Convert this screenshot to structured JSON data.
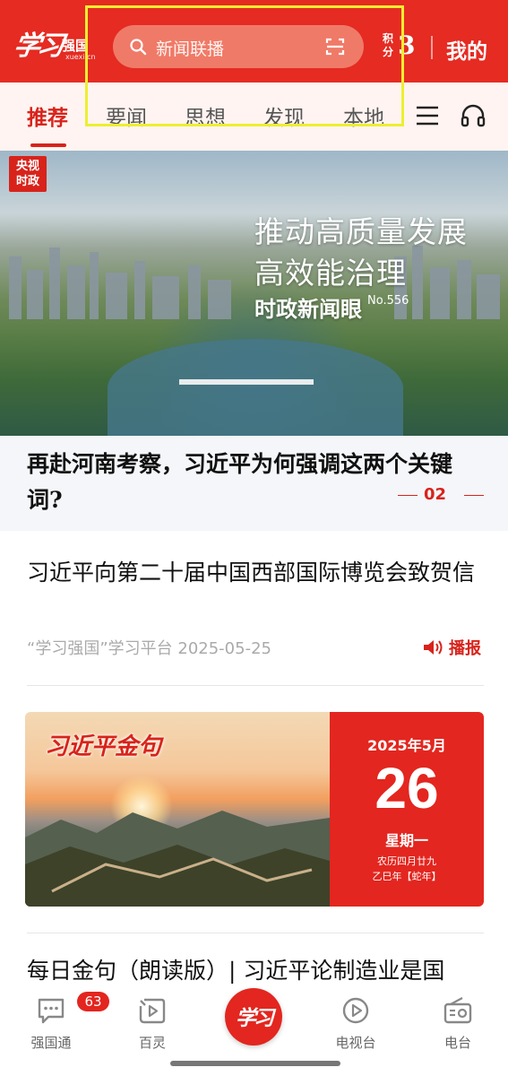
{
  "header": {
    "logo_main": "学习",
    "logo_cn": "强国",
    "logo_en": "xuexi.cn",
    "search_placeholder": "新闻联播",
    "points_label": "积分",
    "points_value": "3",
    "mine_label": "我的",
    "accent_color": "#e52b22"
  },
  "tabs": {
    "items": [
      "推荐",
      "要闻",
      "思想",
      "发现",
      "本地"
    ],
    "active_index": 0,
    "menu_icon": "menu-icon",
    "audio_icon": "headset-icon"
  },
  "banner": {
    "badge_line1": "央视",
    "badge_line2": "时政",
    "title_line1": "推动高质量发展",
    "title_line2": "高效能治理",
    "subtitle": "时政新闻眼",
    "issue_no": "No.556",
    "caption": "再赴河南考察，习近平为何强调这两个关键词?",
    "page_number": "02"
  },
  "article": {
    "title": "习近平向第二十届中国西部国际博览会致贺信",
    "source_date": "“学习强国”学习平台  2025-05-25",
    "broadcast_label": "播报"
  },
  "quote_card": {
    "headline": "习近平金句",
    "year_month": "2025年5月",
    "day": "26",
    "weekday": "星期一",
    "lunar": "农历四月廿九",
    "ganzhi_year": "乙巳年【蛇年】"
  },
  "next_article": {
    "title": "每日金句（朗读版）| 习近平论制造业是国"
  },
  "bottom_nav": {
    "items": [
      {
        "label": "强国通",
        "icon": "chat-icon",
        "badge": "63"
      },
      {
        "label": "百灵",
        "icon": "video-icon"
      },
      {
        "label": "学习",
        "icon": "study-logo"
      },
      {
        "label": "电视台",
        "icon": "play-icon"
      },
      {
        "label": "电台",
        "icon": "radio-icon"
      }
    ]
  }
}
